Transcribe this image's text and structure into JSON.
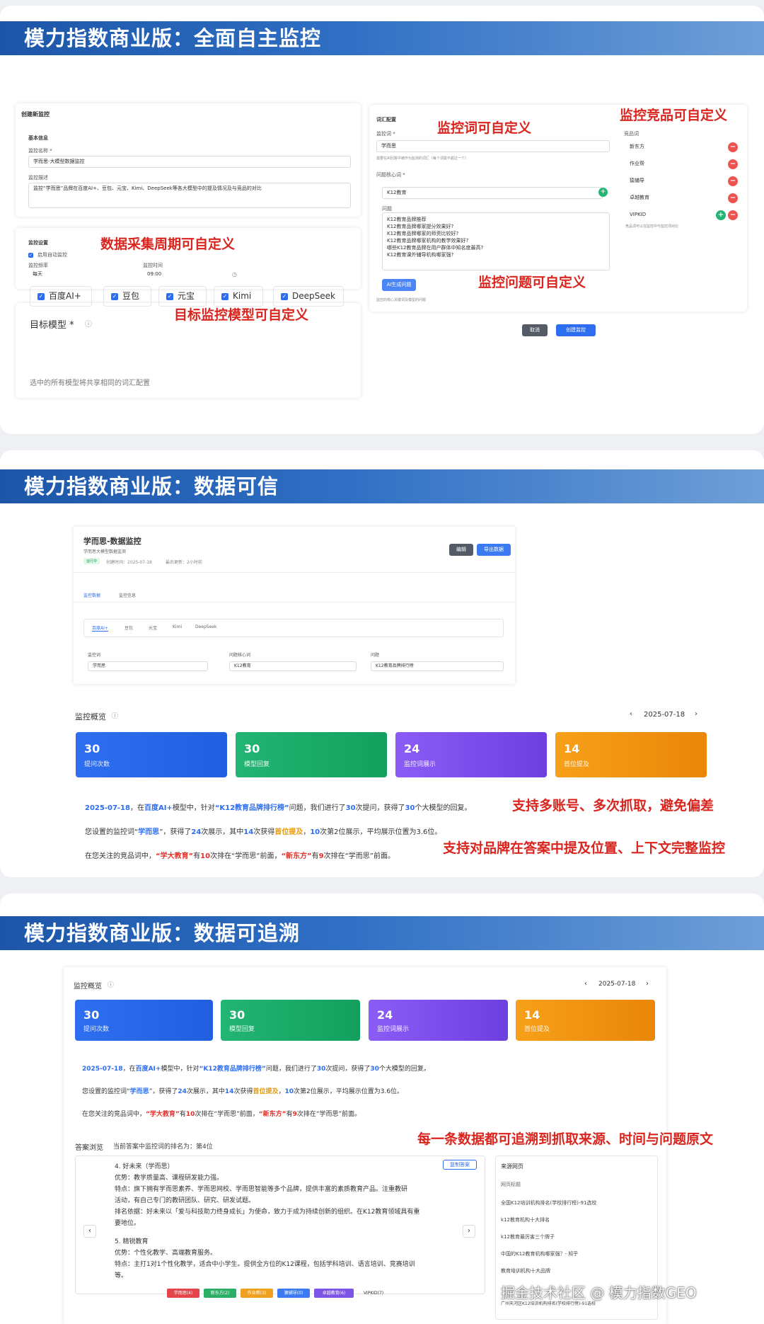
{
  "banners": {
    "s1": "模力指数商业版：全面自主监控",
    "s2": "模力指数商业版：数据可信",
    "s3": "模力指数商业版：数据可追溯"
  },
  "s1": {
    "create_title": "创建新监控",
    "basic_info": "基本信息",
    "name_label": "监控名称 *",
    "name_value": "学而思-大模型数据监控",
    "desc_label": "监控描述",
    "desc_value": "监控“学而思”品牌在百度AI+、豆包、元宝、Kimi、DeepSeek等各大模型中的提及情况及与竞品的对比",
    "monitor_settings": "监控设置",
    "auto_enable": "启用自动监控",
    "freq_label": "监控频率",
    "freq_value": "每天",
    "time_label": "监控时间",
    "time_value": "09:00",
    "target_models": "目标模型 *",
    "models": [
      "百度AI+",
      "豆包",
      "元宝",
      "Kimi",
      "DeepSeek"
    ],
    "models_note": "选中的所有模型将共享相同的词汇配置",
    "vocab_title": "词汇配置",
    "kw_label": "监控词 *",
    "kw_value": "学而思",
    "kw_note": "需要在AI回答中被作为监测的词汇（每个词需不超过一个）",
    "core_label": "问题核心词 *",
    "core_value": "K12教育",
    "questions_label": "问题",
    "questions": [
      "K12教育品牌推荐",
      "K12教育品牌哪家提分效果好?",
      "K12教育品牌哪家的师资比较好?",
      "K12教育品牌哪家机构的教学效果好?",
      "哪些K12教育品牌在用户群体中知名度最高?",
      "K12教育课外辅导机构哪家强?"
    ],
    "gen_btn": "AI生成问题",
    "q_note": "监控的核心关键词及模型的问题",
    "comp_label": "竞品词",
    "competitors": [
      "新东方",
      "作业帮",
      "猿辅导",
      "卓越教育",
      "VIPKID"
    ],
    "comp_note": "竞品词可以在监控中与监控词对比",
    "cancel": "取消",
    "create": "创建监控"
  },
  "s2": {
    "title": "学而思-数据监控",
    "subtitle": "学而思大模型数据监测",
    "status": "运行中",
    "created": "创建时间：2025-07-18",
    "last": "最后更新：2小时前",
    "edit": "编辑",
    "export": "导出数据",
    "tabs": [
      "监控数据",
      "监控信息"
    ],
    "model_tabs": [
      "百度AI+",
      "豆包",
      "元宝",
      "Kimi",
      "DeepSeek"
    ],
    "f1_label": "监控词",
    "f1_value": "学而思",
    "f2_label": "问题核心词",
    "f2_value": "K12教育",
    "f3_label": "问题",
    "f3_value": "K12教育品牌排行榜",
    "overview": "监控概览",
    "date": "2025-07-18",
    "stats": [
      {
        "n": "30",
        "l": "提问次数"
      },
      {
        "n": "30",
        "l": "模型回复"
      },
      {
        "n": "24",
        "l": "监控词展示"
      },
      {
        "n": "14",
        "l": "首位提及"
      }
    ],
    "s_a1": "2025-07-18",
    "s_a2": "，在",
    "s_a3": "百度AI+",
    "s_a4": "模型中，针对",
    "s_a5": "“K12教育品牌排行榜”",
    "s_a6": "问题，我们进行了",
    "s_a7": "30",
    "s_a8": "次提问，获得了",
    "s_a9": "30",
    "s_a10": "个大模型的回复。",
    "s_b1": "您设置的监控词“",
    "s_b2": "学而思",
    "s_b3": "”，获得了",
    "s_b4": "24",
    "s_b5": "次展示，其中",
    "s_b6": "14",
    "s_b7": "次获得",
    "s_b8": "首位提及",
    "s_b9": "，",
    "s_b10": "10",
    "s_b11": "次第2位展示，平均展示位置为3.6位。",
    "s_c1": "在您关注的竞品词中，",
    "s_c2": "“学大教育”",
    "s_c3": "有",
    "s_c4": "10",
    "s_c5": "次排在“学而思”前面，",
    "s_c6": "“新东方”",
    "s_c7": "有",
    "s_c8": "9",
    "s_c9": "次排在“学而思”前面。",
    "ann1": "支持多账号、多次抓取，避免偏差",
    "ann2": "支持对品牌在答案中提及位置、上下文完整监控"
  },
  "s3": {
    "overview": "监控概览",
    "date": "2025-07-18",
    "answer_browse": "答案浏览",
    "rank_text": "当前答案中监控词的排名为：第4位",
    "copy": "复制答案",
    "a_title": "4. 好未来（学而思）",
    "a_adv": "优势：教学质量高、课程研发能力强。",
    "a_feat1": "特点：旗下拥有学而思素养、学而思网校、学而思智能等多个品牌，提供丰富的素质教育产品。注重教研",
    "a_feat2": "活动，有自己专门的教研团队、研究、研发试题。",
    "a_rank1": "排名依据：好未来以「爱与科技助力终身成长」为使命，致力于成为持续创新的组织。在K12教育领域具有重",
    "a_rank2": "要地位。",
    "b_title": "5. 精锐教育",
    "b_adv": "优势：个性化教学、高端教育服务。",
    "b_feat1": "特点：主打1对1个性化教学，适合中小学生。提供全方位的K12课程，包括学科培训、语言培训、竞赛培训",
    "b_feat2": "等。",
    "tags": [
      "学而思(4)",
      "新东方(2)",
      "作业帮(3)",
      "猿辅导(0)",
      "卓越教育(6)",
      "VIPKID(7)"
    ],
    "sources_title": "来源网页",
    "sources_header": "网页标题",
    "sources": [
      "全国K12培训机构排名(学校排行榜)-91选校",
      "k12教育机构十大排名",
      "k12教育最厉害三个牌子",
      "中国的K12教育机构哪家强？- 知乎",
      "教育培训机构十大品牌",
      "广州天河区K12培训机构排名(学校排行榜)-91选校"
    ],
    "ann": "每一条数据都可追溯到抓取来源、时间与问题原文",
    "watermark": "掘金技术社区 @ 模力指数GEO"
  },
  "annotations": {
    "a1": "监控词可自定义",
    "a2": "监控竞品可自定义",
    "a3": "数据采集周期可自定义",
    "a4": "监控问题可自定义",
    "a5": "目标监控模型可自定义"
  }
}
